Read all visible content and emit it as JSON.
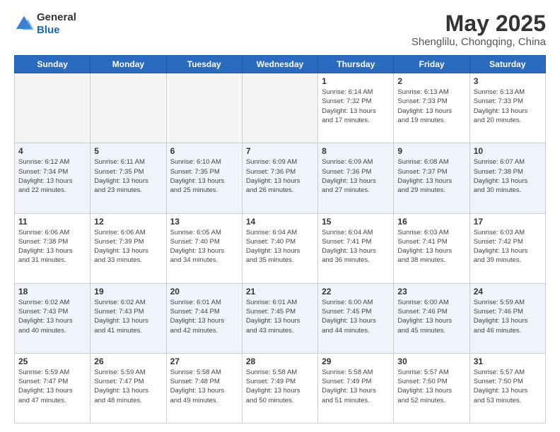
{
  "header": {
    "logo_general": "General",
    "logo_blue": "Blue",
    "title": "May 2025",
    "location": "Shenglilu, Chongqing, China"
  },
  "days_of_week": [
    "Sunday",
    "Monday",
    "Tuesday",
    "Wednesday",
    "Thursday",
    "Friday",
    "Saturday"
  ],
  "weeks": [
    {
      "shade": false,
      "days": [
        {
          "number": "",
          "info": ""
        },
        {
          "number": "",
          "info": ""
        },
        {
          "number": "",
          "info": ""
        },
        {
          "number": "",
          "info": ""
        },
        {
          "number": "1",
          "info": "Sunrise: 6:14 AM\nSunset: 7:32 PM\nDaylight: 13 hours\nand 17 minutes."
        },
        {
          "number": "2",
          "info": "Sunrise: 6:13 AM\nSunset: 7:33 PM\nDaylight: 13 hours\nand 19 minutes."
        },
        {
          "number": "3",
          "info": "Sunrise: 6:13 AM\nSunset: 7:33 PM\nDaylight: 13 hours\nand 20 minutes."
        }
      ]
    },
    {
      "shade": true,
      "days": [
        {
          "number": "4",
          "info": "Sunrise: 6:12 AM\nSunset: 7:34 PM\nDaylight: 13 hours\nand 22 minutes."
        },
        {
          "number": "5",
          "info": "Sunrise: 6:11 AM\nSunset: 7:35 PM\nDaylight: 13 hours\nand 23 minutes."
        },
        {
          "number": "6",
          "info": "Sunrise: 6:10 AM\nSunset: 7:35 PM\nDaylight: 13 hours\nand 25 minutes."
        },
        {
          "number": "7",
          "info": "Sunrise: 6:09 AM\nSunset: 7:36 PM\nDaylight: 13 hours\nand 26 minutes."
        },
        {
          "number": "8",
          "info": "Sunrise: 6:09 AM\nSunset: 7:36 PM\nDaylight: 13 hours\nand 27 minutes."
        },
        {
          "number": "9",
          "info": "Sunrise: 6:08 AM\nSunset: 7:37 PM\nDaylight: 13 hours\nand 29 minutes."
        },
        {
          "number": "10",
          "info": "Sunrise: 6:07 AM\nSunset: 7:38 PM\nDaylight: 13 hours\nand 30 minutes."
        }
      ]
    },
    {
      "shade": false,
      "days": [
        {
          "number": "11",
          "info": "Sunrise: 6:06 AM\nSunset: 7:38 PM\nDaylight: 13 hours\nand 31 minutes."
        },
        {
          "number": "12",
          "info": "Sunrise: 6:06 AM\nSunset: 7:39 PM\nDaylight: 13 hours\nand 33 minutes."
        },
        {
          "number": "13",
          "info": "Sunrise: 6:05 AM\nSunset: 7:40 PM\nDaylight: 13 hours\nand 34 minutes."
        },
        {
          "number": "14",
          "info": "Sunrise: 6:04 AM\nSunset: 7:40 PM\nDaylight: 13 hours\nand 35 minutes."
        },
        {
          "number": "15",
          "info": "Sunrise: 6:04 AM\nSunset: 7:41 PM\nDaylight: 13 hours\nand 36 minutes."
        },
        {
          "number": "16",
          "info": "Sunrise: 6:03 AM\nSunset: 7:41 PM\nDaylight: 13 hours\nand 38 minutes."
        },
        {
          "number": "17",
          "info": "Sunrise: 6:03 AM\nSunset: 7:42 PM\nDaylight: 13 hours\nand 39 minutes."
        }
      ]
    },
    {
      "shade": true,
      "days": [
        {
          "number": "18",
          "info": "Sunrise: 6:02 AM\nSunset: 7:43 PM\nDaylight: 13 hours\nand 40 minutes."
        },
        {
          "number": "19",
          "info": "Sunrise: 6:02 AM\nSunset: 7:43 PM\nDaylight: 13 hours\nand 41 minutes."
        },
        {
          "number": "20",
          "info": "Sunrise: 6:01 AM\nSunset: 7:44 PM\nDaylight: 13 hours\nand 42 minutes."
        },
        {
          "number": "21",
          "info": "Sunrise: 6:01 AM\nSunset: 7:45 PM\nDaylight: 13 hours\nand 43 minutes."
        },
        {
          "number": "22",
          "info": "Sunrise: 6:00 AM\nSunset: 7:45 PM\nDaylight: 13 hours\nand 44 minutes."
        },
        {
          "number": "23",
          "info": "Sunrise: 6:00 AM\nSunset: 7:46 PM\nDaylight: 13 hours\nand 45 minutes."
        },
        {
          "number": "24",
          "info": "Sunrise: 5:59 AM\nSunset: 7:46 PM\nDaylight: 13 hours\nand 46 minutes."
        }
      ]
    },
    {
      "shade": false,
      "days": [
        {
          "number": "25",
          "info": "Sunrise: 5:59 AM\nSunset: 7:47 PM\nDaylight: 13 hours\nand 47 minutes."
        },
        {
          "number": "26",
          "info": "Sunrise: 5:59 AM\nSunset: 7:47 PM\nDaylight: 13 hours\nand 48 minutes."
        },
        {
          "number": "27",
          "info": "Sunrise: 5:58 AM\nSunset: 7:48 PM\nDaylight: 13 hours\nand 49 minutes."
        },
        {
          "number": "28",
          "info": "Sunrise: 5:58 AM\nSunset: 7:49 PM\nDaylight: 13 hours\nand 50 minutes."
        },
        {
          "number": "29",
          "info": "Sunrise: 5:58 AM\nSunset: 7:49 PM\nDaylight: 13 hours\nand 51 minutes."
        },
        {
          "number": "30",
          "info": "Sunrise: 5:57 AM\nSunset: 7:50 PM\nDaylight: 13 hours\nand 52 minutes."
        },
        {
          "number": "31",
          "info": "Sunrise: 5:57 AM\nSunset: 7:50 PM\nDaylight: 13 hours\nand 53 minutes."
        }
      ]
    }
  ]
}
